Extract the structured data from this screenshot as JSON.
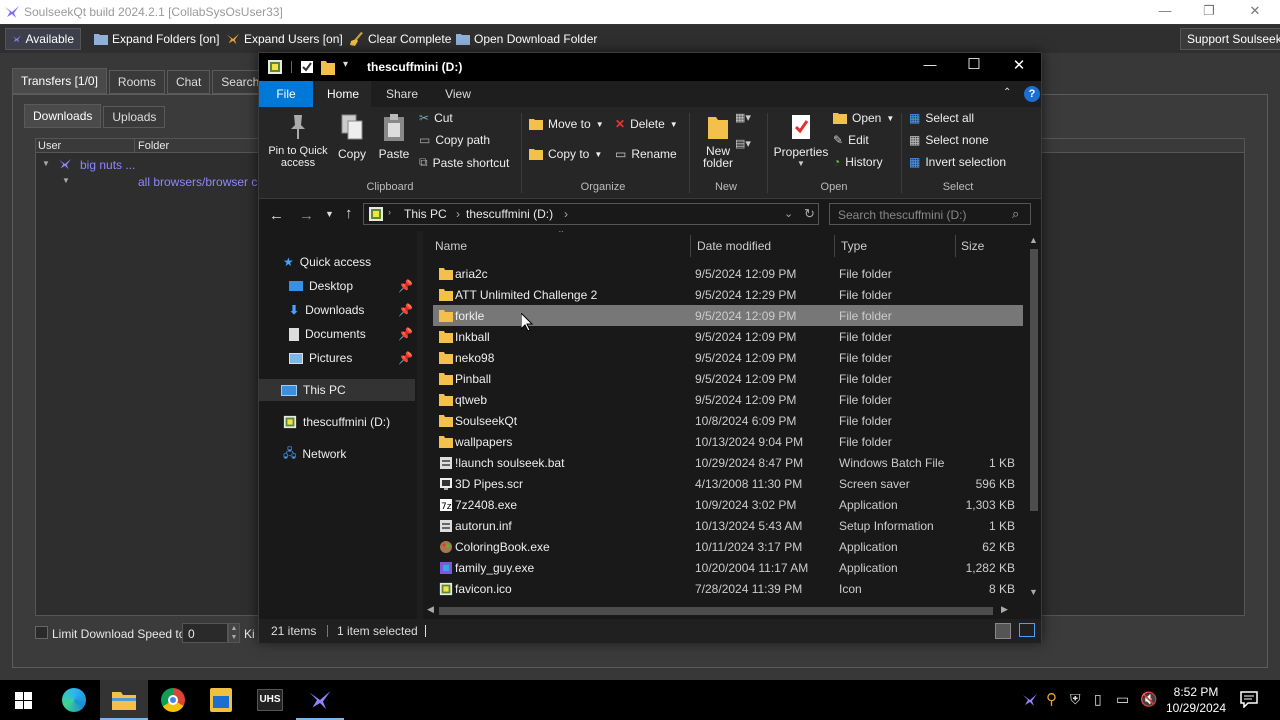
{
  "slsk": {
    "title": "SoulseekQt build 2024.2.1 [CollabSysOsUser33]",
    "toolbar": {
      "status": "Available",
      "expand_folders": "Expand Folders [on]",
      "expand_users": "Expand Users [on]",
      "clear_complete": "Clear Complete",
      "open_download_folder": "Open Download Folder",
      "support": "Support Soulseek!"
    },
    "tabs": [
      "Transfers [1/0]",
      "Rooms",
      "Chat",
      "Search"
    ],
    "subtabs": [
      "Downloads",
      "Uploads"
    ],
    "columns": [
      "User",
      "Folder"
    ],
    "row_user": "big nuts ...",
    "row_folder": "all browsers/browser c...",
    "limit_label": "Limit Download Speed to",
    "limit_value": "0",
    "limit_unit": "Ki"
  },
  "explorer": {
    "title": "thescuffmini (D:)",
    "ribbon_tabs": [
      "File",
      "Home",
      "Share",
      "View"
    ],
    "clipboard": {
      "pin": "Pin to Quick access",
      "copy": "Copy",
      "paste": "Paste",
      "cut": "Cut",
      "copy_path": "Copy path",
      "paste_shortcut": "Paste shortcut",
      "group": "Clipboard"
    },
    "organize": {
      "move_to": "Move to",
      "copy_to": "Copy to",
      "delete": "Delete",
      "rename": "Rename",
      "group": "Organize"
    },
    "new": {
      "new_folder": "New folder",
      "group": "New"
    },
    "open": {
      "properties": "Properties",
      "open": "Open",
      "edit": "Edit",
      "history": "History",
      "group": "Open"
    },
    "select": {
      "select_all": "Select all",
      "select_none": "Select none",
      "invert": "Invert selection",
      "group": "Select"
    },
    "address": {
      "part1": "This PC",
      "part2": "thescuffmini (D:)"
    },
    "search_placeholder": "Search thescuffmini (D:)",
    "nav": {
      "quick_access": "Quick access",
      "desktop": "Desktop",
      "downloads": "Downloads",
      "documents": "Documents",
      "pictures": "Pictures",
      "this_pc": "This PC",
      "drive": "thescuffmini (D:)",
      "network": "Network"
    },
    "columns": {
      "name": "Name",
      "date": "Date modified",
      "type": "Type",
      "size": "Size"
    },
    "files": [
      {
        "name": "aria2c",
        "date": "9/5/2024 12:09 PM",
        "type": "File folder",
        "size": ""
      },
      {
        "name": "ATT Unlimited Challenge 2",
        "date": "9/5/2024 12:29 PM",
        "type": "File folder",
        "size": ""
      },
      {
        "name": "forkle",
        "date": "9/5/2024 12:09 PM",
        "type": "File folder",
        "size": ""
      },
      {
        "name": "Inkball",
        "date": "9/5/2024 12:09 PM",
        "type": "File folder",
        "size": ""
      },
      {
        "name": "neko98",
        "date": "9/5/2024 12:09 PM",
        "type": "File folder",
        "size": ""
      },
      {
        "name": "Pinball",
        "date": "9/5/2024 12:09 PM",
        "type": "File folder",
        "size": ""
      },
      {
        "name": "qtweb",
        "date": "9/5/2024 12:09 PM",
        "type": "File folder",
        "size": ""
      },
      {
        "name": "SoulseekQt",
        "date": "10/8/2024 6:09 PM",
        "type": "File folder",
        "size": ""
      },
      {
        "name": "wallpapers",
        "date": "10/13/2024 9:04 PM",
        "type": "File folder",
        "size": ""
      },
      {
        "name": "!launch soulseek.bat",
        "date": "10/29/2024 8:47 PM",
        "type": "Windows Batch File",
        "size": "1 KB"
      },
      {
        "name": "3D Pipes.scr",
        "date": "4/13/2008 11:30 PM",
        "type": "Screen saver",
        "size": "596 KB"
      },
      {
        "name": "7z2408.exe",
        "date": "10/9/2024 3:02 PM",
        "type": "Application",
        "size": "1,303 KB"
      },
      {
        "name": "autorun.inf",
        "date": "10/13/2024 5:43 AM",
        "type": "Setup Information",
        "size": "1 KB"
      },
      {
        "name": "ColoringBook.exe",
        "date": "10/11/2024 3:17 PM",
        "type": "Application",
        "size": "62 KB"
      },
      {
        "name": "family_guy.exe",
        "date": "10/20/2004 11:17 AM",
        "type": "Application",
        "size": "1,282 KB"
      },
      {
        "name": "favicon.ico",
        "date": "7/28/2024 11:39 PM",
        "type": "Icon",
        "size": "8 KB"
      }
    ],
    "status": {
      "count": "21 items",
      "selected": "1 item selected"
    }
  },
  "taskbar": {
    "time": "8:52 PM",
    "date": "10/29/2024",
    "uhs": "UHS"
  },
  "colors": {
    "accent": "#0078d7",
    "folder": "#f3c04b",
    "soulseek_bird": "#7b6cf6"
  }
}
